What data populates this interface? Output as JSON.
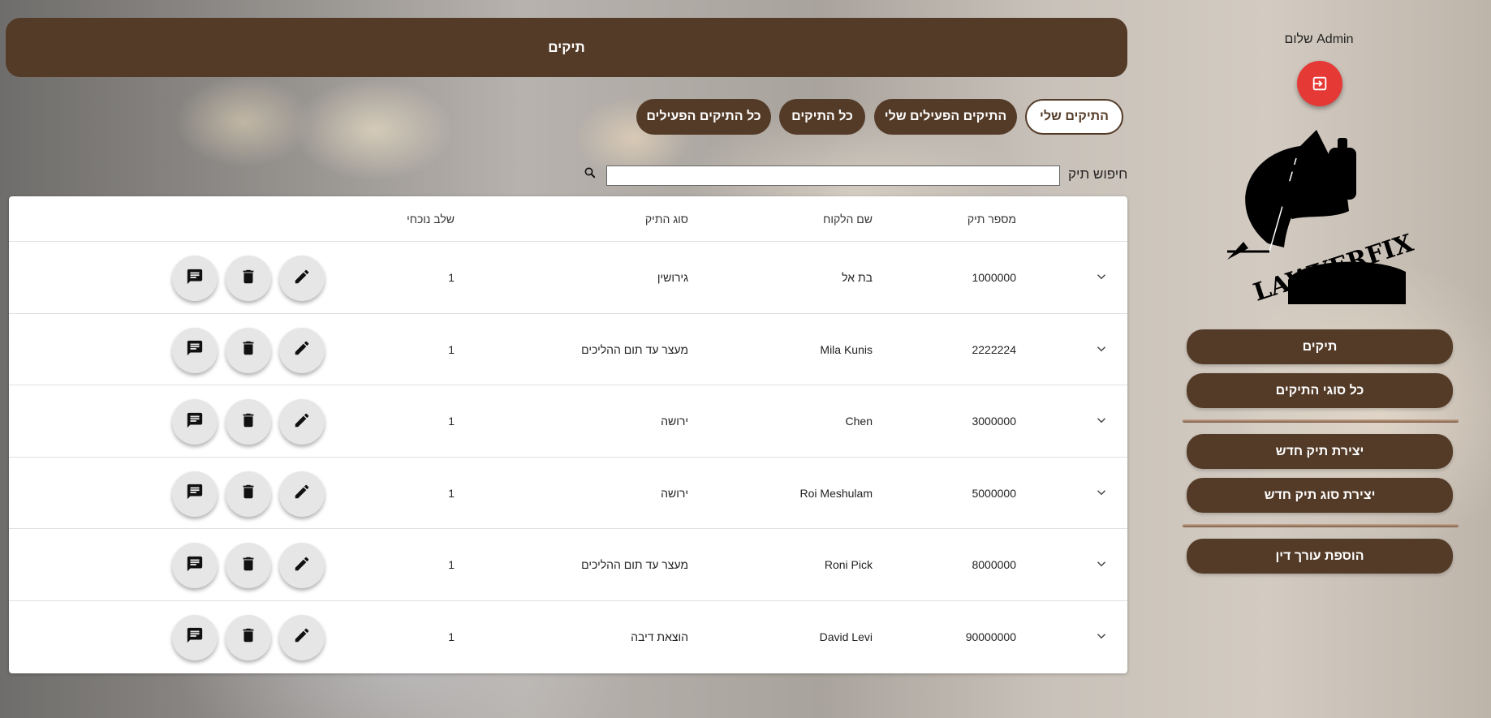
{
  "header": {
    "title": "תיקים"
  },
  "filters": [
    {
      "label": "התיקים שלי",
      "active": true
    },
    {
      "label": "התיקים הפעילים שלי",
      "active": false
    },
    {
      "label": "כל התיקים",
      "active": false
    },
    {
      "label": "כל התיקים הפעילים",
      "active": false
    }
  ],
  "search": {
    "label": "חיפוש תיק",
    "value": "",
    "placeholder": ""
  },
  "table": {
    "columns": [
      "מספר תיק",
      "שם הלקוח",
      "סוג התיק",
      "שלב נוכחי"
    ],
    "rows": [
      {
        "case_number": "1000000",
        "client": "בת אל",
        "type": "גירושין",
        "stage": "1"
      },
      {
        "case_number": "2222224",
        "client": "Mila Kunis",
        "type": "מעצר עד תום ההליכים",
        "stage": "1"
      },
      {
        "case_number": "3000000",
        "client": "Chen",
        "type": "ירושה",
        "stage": "1"
      },
      {
        "case_number": "5000000",
        "client": "Roi Meshulam",
        "type": "ירושה",
        "stage": "1"
      },
      {
        "case_number": "8000000",
        "client": "Roni Pick",
        "type": "מעצר עד תום ההליכים",
        "stage": "1"
      },
      {
        "case_number": "90000000",
        "client": "David Levi",
        "type": "הוצאת דיבה",
        "stage": "1"
      }
    ]
  },
  "sidebar": {
    "greeting": "שלום Admin",
    "logo_text": "LAWYERFIX",
    "items": [
      {
        "label": "תיקים"
      },
      {
        "label": "כל סוגי התיקים"
      },
      {
        "label": "יצירת תיק חדש"
      },
      {
        "label": "יצירת סוג תיק חדש"
      },
      {
        "label": "הוספת עורך דין"
      }
    ]
  },
  "colors": {
    "brand": "#543b28",
    "logout": "#e53935",
    "button_bg": "#e6e6e6"
  },
  "icons": [
    "search-icon",
    "expand-chevron-icon",
    "edit-pencil-icon",
    "delete-trash-icon",
    "comment-icon",
    "logout-icon",
    "lawyerfix-logo"
  ]
}
